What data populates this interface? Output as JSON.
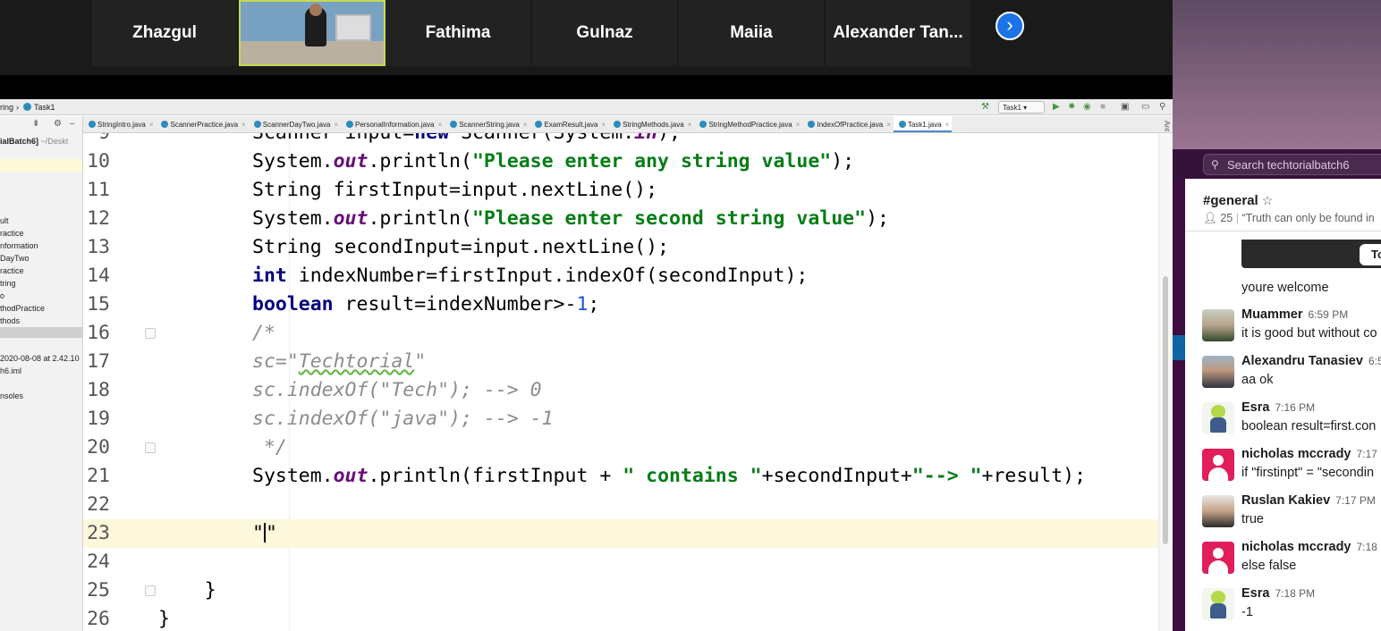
{
  "zoom": {
    "participants": [
      "Zhazgul",
      "Fathima",
      "Gulnaz",
      "Maiia",
      "Alexander Tan..."
    ]
  },
  "ide": {
    "breadcrumb": [
      "ring",
      "Task1"
    ],
    "run_config": "Task1",
    "tabs": [
      {
        "label": "StringIntro.java"
      },
      {
        "label": "ScannerPractice.java"
      },
      {
        "label": "ScannerDayTwo.java"
      },
      {
        "label": "PersonalInformation.java"
      },
      {
        "label": "ScannerString.java"
      },
      {
        "label": "ExamResult.java"
      },
      {
        "label": "StringMethods.java"
      },
      {
        "label": "StringMethodPractice.java"
      },
      {
        "label": "IndexOfPractice.java"
      },
      {
        "label": "Task1.java",
        "active": true
      }
    ],
    "project": {
      "root_name": "ialBatch6]",
      "root_path": "~/Deskt",
      "items": [
        "ult",
        "ractice",
        "nformation",
        "DayTwo",
        "ractice",
        "tring",
        "o",
        "thodPractice",
        "thods",
        "",
        "",
        "2020-08-08 at 2.42.10",
        "h6.iml",
        "",
        "nsoles"
      ]
    },
    "right_strip_label": "Ant",
    "current_line": 23,
    "lines": [
      {
        "n": "9",
        "segs": [
          [
            "",
            "Scanner input="
          ],
          [
            "kw",
            "new"
          ],
          [
            "",
            " Scanner(System."
          ],
          [
            "fld",
            "in"
          ],
          [
            "",
            ");"
          ]
        ]
      },
      {
        "n": "10",
        "segs": [
          [
            "",
            "System."
          ],
          [
            "fld",
            "out"
          ],
          [
            "",
            ".println("
          ],
          [
            "str",
            "\"Please enter any string value\""
          ],
          [
            "",
            ");"
          ]
        ]
      },
      {
        "n": "11",
        "segs": [
          [
            "",
            "String firstInput=input.nextLine();"
          ]
        ]
      },
      {
        "n": "12",
        "segs": [
          [
            "",
            "System."
          ],
          [
            "fld",
            "out"
          ],
          [
            "",
            ".println("
          ],
          [
            "str",
            "\"Please enter second string value\""
          ],
          [
            "",
            ");"
          ]
        ]
      },
      {
        "n": "13",
        "segs": [
          [
            "",
            "String secondInput=input.nextLine();"
          ]
        ]
      },
      {
        "n": "14",
        "segs": [
          [
            "kw",
            "int"
          ],
          [
            "",
            " indexNumber=firstInput.indexOf(secondInput);"
          ]
        ]
      },
      {
        "n": "15",
        "segs": [
          [
            "kw",
            "boolean"
          ],
          [
            "",
            " result=indexNumber>-"
          ],
          [
            "num",
            "1"
          ],
          [
            "",
            ";"
          ]
        ]
      },
      {
        "n": "16",
        "segs": [
          [
            "cmt",
            "/*"
          ]
        ],
        "fold": true
      },
      {
        "n": "17",
        "segs": [
          [
            "cmt",
            "sc=\""
          ],
          [
            "cmt squig",
            "Techtorial"
          ],
          [
            "cmt",
            "\""
          ]
        ]
      },
      {
        "n": "18",
        "segs": [
          [
            "cmt",
            "sc.indexOf(\"Tech\"); --> 0"
          ]
        ]
      },
      {
        "n": "19",
        "segs": [
          [
            "cmt",
            "sc.indexOf(\"java\"); --> -1"
          ]
        ]
      },
      {
        "n": "20",
        "segs": [
          [
            "cmt",
            " */"
          ]
        ],
        "fold": true
      },
      {
        "n": "21",
        "segs": [
          [
            "",
            "System."
          ],
          [
            "fld",
            "out"
          ],
          [
            "",
            ".println(firstInput + "
          ],
          [
            "str",
            "\" contains \""
          ],
          [
            "",
            "+secondInput+"
          ],
          [
            "str",
            "\"--> \""
          ],
          [
            "",
            "+result);"
          ]
        ]
      },
      {
        "n": "22",
        "segs": []
      },
      {
        "n": "23",
        "segs": [
          [
            "",
            "\""
          ],
          [
            "caret",
            ""
          ],
          [
            "",
            "\""
          ]
        ]
      },
      {
        "n": "24",
        "segs": []
      },
      {
        "n": "25",
        "segs": [
          [
            "",
            "    }"
          ]
        ],
        "indent_override": true,
        "fold": true
      },
      {
        "n": "26",
        "segs": [
          [
            "",
            "}"
          ]
        ],
        "indent_override": true
      }
    ]
  },
  "slack": {
    "search_placeholder": "Search techtorialbatch6",
    "channel": "#general",
    "members": "25",
    "topic": "“Truth can only be found in",
    "card_button": "To",
    "messages": [
      {
        "text": "youre welcome",
        "continued": true
      },
      {
        "name": "Muammer",
        "time": "6:59 PM",
        "text": "it is good but without co",
        "avatar": "photo"
      },
      {
        "name": "Alexandru Tanasiev",
        "time": "6:5",
        "text": "aa ok",
        "avatar": "photo2"
      },
      {
        "name": "Esra",
        "time": "7:16 PM",
        "text": "boolean result=first.con",
        "avatar": "cartoon"
      },
      {
        "name": "nicholas mccrady",
        "time": "7:17 P",
        "text": "if \"firstinpt\"  = \"secondin",
        "avatar": "pink"
      },
      {
        "name": "Ruslan Kakiev",
        "time": "7:17 PM",
        "text": "true",
        "avatar": "photo3"
      },
      {
        "name": "nicholas mccrady",
        "time": "7:18 P",
        "text": "else false",
        "avatar": "pink"
      },
      {
        "name": "Esra",
        "time": "7:18 PM",
        "text": "-1",
        "avatar": "cartoon"
      }
    ]
  }
}
